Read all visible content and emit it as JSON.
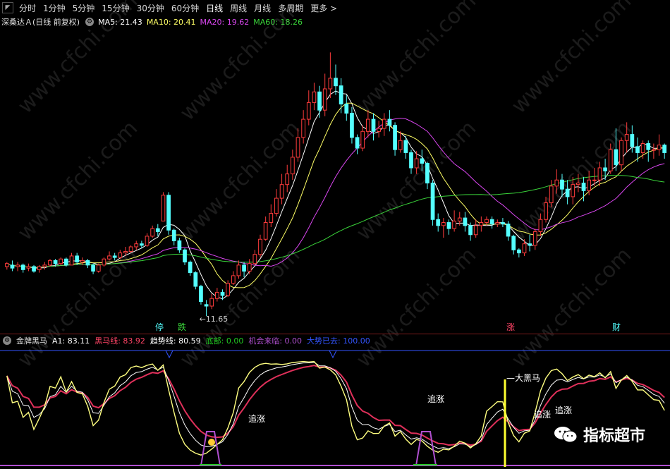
{
  "toolbar": {
    "tabs": [
      "分时",
      "1分钟",
      "5分钟",
      "15分钟",
      "30分钟",
      "60分钟",
      "日线",
      "周线",
      "月线",
      "多周期",
      "更多 >"
    ],
    "active": "日线"
  },
  "main_legend": {
    "stock": "深桑达Ａ(日线 前复权)",
    "ma5": "MA5: 21.43",
    "ma10": "MA10: 20.41",
    "ma20": "MA20: 19.62",
    "ma60": "MA60: 18.26",
    "colors": {
      "ma5": "#ffffff",
      "ma10": "#ffff66",
      "ma20": "#d946ef",
      "ma60": "#3ad43a"
    }
  },
  "annotations": {
    "low": "11.65",
    "ting": "停",
    "die": "跌",
    "zhang": "涨",
    "cai": "财"
  },
  "sub_legend": {
    "name": "金牌黑马",
    "a1": "A1: 83.11",
    "heima": "黑马线: 83.92",
    "qushi": "趋势线: 80.59",
    "dibu": "底部: 0.00",
    "jihui": "机会来临: 0.00",
    "dashi": "大势已去: 100.00",
    "colors": {
      "a1": "#ffffff",
      "heima": "#ff4466",
      "qushi": "#ffffff",
      "dibu": "#22cc22",
      "jihui": "#b050d0",
      "dashi": "#3355ff"
    }
  },
  "sub_labels": {
    "zhuizhang": "追涨",
    "daheima": "大黑马"
  },
  "chart_data": {
    "type": "candlestick",
    "candles": [
      [
        14.9,
        15.1,
        14.7,
        15.2
      ],
      [
        15.0,
        14.8,
        14.6,
        15.3
      ],
      [
        14.9,
        15.0,
        14.6,
        15.2
      ],
      [
        15.0,
        14.7,
        14.5,
        15.1
      ],
      [
        14.8,
        14.9,
        14.6,
        15.1
      ],
      [
        14.9,
        14.6,
        14.5,
        15.0
      ],
      [
        14.7,
        14.9,
        14.5,
        15.0
      ],
      [
        14.9,
        15.0,
        14.7,
        15.2
      ],
      [
        15.0,
        15.3,
        14.9,
        15.4
      ],
      [
        15.3,
        15.1,
        14.9,
        15.4
      ],
      [
        15.1,
        15.4,
        15.0,
        15.5
      ],
      [
        15.4,
        15.0,
        14.9,
        15.5
      ],
      [
        15.0,
        15.6,
        15.0,
        15.8
      ],
      [
        15.6,
        15.2,
        15.0,
        15.8
      ],
      [
        15.2,
        15.3,
        15.0,
        15.5
      ],
      [
        15.3,
        15.0,
        14.8,
        15.4
      ],
      [
        15.0,
        14.6,
        14.4,
        15.1
      ],
      [
        14.6,
        15.0,
        14.5,
        15.1
      ],
      [
        15.0,
        15.4,
        14.9,
        15.5
      ],
      [
        15.4,
        15.6,
        15.3,
        15.9
      ],
      [
        15.6,
        15.5,
        15.3,
        15.8
      ],
      [
        15.5,
        15.8,
        15.4,
        16.0
      ],
      [
        15.8,
        15.9,
        15.6,
        16.2
      ],
      [
        15.9,
        16.2,
        15.8,
        16.3
      ],
      [
        16.2,
        16.4,
        16.0,
        16.6
      ],
      [
        16.4,
        16.3,
        16.1,
        16.6
      ],
      [
        16.3,
        16.9,
        16.2,
        17.1
      ],
      [
        16.9,
        17.4,
        16.8,
        17.6
      ],
      [
        17.4,
        17.2,
        16.9,
        17.7
      ],
      [
        17.9,
        19.6,
        17.9,
        19.8
      ],
      [
        19.6,
        17.3,
        17.0,
        19.8
      ],
      [
        17.3,
        16.6,
        16.3,
        17.4
      ],
      [
        16.6,
        16.0,
        15.8,
        16.8
      ],
      [
        16.0,
        15.2,
        15.0,
        16.1
      ],
      [
        15.2,
        14.5,
        14.3,
        15.3
      ],
      [
        14.5,
        13.6,
        13.4,
        14.6
      ],
      [
        13.6,
        12.6,
        12.4,
        13.7
      ],
      [
        12.4,
        12.3,
        11.65,
        12.7
      ],
      [
        12.3,
        12.8,
        12.1,
        13.1
      ],
      [
        12.8,
        13.2,
        12.6,
        13.5
      ],
      [
        13.2,
        13.0,
        12.7,
        13.4
      ],
      [
        13.0,
        13.8,
        12.9,
        14.0
      ],
      [
        13.8,
        14.3,
        13.7,
        14.6
      ],
      [
        14.3,
        15.0,
        14.1,
        15.3
      ],
      [
        15.0,
        14.6,
        14.2,
        15.2
      ],
      [
        14.6,
        15.1,
        14.4,
        15.4
      ],
      [
        15.1,
        15.7,
        15.0,
        16.0
      ],
      [
        15.7,
        16.7,
        15.5,
        17.0
      ],
      [
        16.7,
        17.8,
        16.6,
        18.2
      ],
      [
        17.8,
        18.4,
        17.5,
        19.0
      ],
      [
        18.4,
        19.4,
        18.2,
        20.0
      ],
      [
        19.4,
        20.3,
        19.0,
        21.0
      ],
      [
        20.3,
        21.0,
        19.8,
        21.6
      ],
      [
        21.0,
        22.1,
        20.6,
        22.6
      ],
      [
        22.1,
        23.4,
        21.8,
        24.0
      ],
      [
        23.4,
        24.6,
        23.0,
        25.2
      ],
      [
        24.6,
        25.7,
        24.2,
        26.5
      ],
      [
        25.7,
        26.4,
        25.2,
        27.0
      ],
      [
        26.4,
        25.2,
        24.7,
        26.8
      ],
      [
        25.2,
        26.6,
        24.8,
        27.6
      ],
      [
        26.6,
        27.3,
        26.0,
        29.0
      ],
      [
        27.3,
        26.8,
        26.2,
        28.2
      ],
      [
        26.8,
        25.6,
        25.0,
        27.3
      ],
      [
        25.6,
        25.0,
        24.5,
        26.2
      ],
      [
        25.0,
        23.4,
        23.0,
        25.4
      ],
      [
        23.4,
        22.7,
        22.3,
        23.6
      ],
      [
        22.7,
        23.8,
        22.5,
        24.2
      ],
      [
        23.8,
        24.6,
        23.4,
        25.2
      ],
      [
        24.6,
        23.8,
        23.2,
        25.0
      ],
      [
        23.8,
        24.0,
        23.4,
        24.5
      ],
      [
        24.0,
        24.6,
        23.5,
        25.0
      ],
      [
        24.6,
        24.2,
        23.8,
        25.2
      ],
      [
        24.2,
        22.6,
        22.2,
        24.4
      ],
      [
        22.6,
        23.2,
        22.4,
        23.8
      ],
      [
        23.2,
        22.4,
        22.0,
        23.5
      ],
      [
        22.4,
        21.4,
        21.0,
        22.6
      ],
      [
        21.4,
        22.0,
        21.0,
        22.5
      ],
      [
        22.0,
        21.7,
        21.2,
        22.6
      ],
      [
        21.7,
        20.4,
        20.0,
        21.8
      ],
      [
        20.4,
        18.0,
        17.6,
        20.6
      ],
      [
        18.0,
        17.6,
        17.2,
        18.4
      ],
      [
        17.6,
        17.8,
        16.8,
        18.1
      ],
      [
        17.8,
        17.4,
        17.0,
        18.0
      ],
      [
        17.4,
        17.9,
        17.2,
        18.6
      ],
      [
        17.9,
        18.1,
        17.6,
        18.5
      ],
      [
        18.1,
        17.6,
        17.2,
        18.5
      ],
      [
        17.6,
        17.0,
        16.6,
        17.8
      ],
      [
        17.0,
        17.6,
        16.8,
        18.0
      ],
      [
        17.6,
        17.8,
        17.2,
        18.2
      ],
      [
        17.8,
        18.0,
        17.6,
        18.2
      ],
      [
        18.0,
        17.7,
        17.4,
        18.2
      ],
      [
        17.7,
        17.8,
        17.5,
        18.0
      ],
      [
        17.8,
        17.7,
        17.5,
        18.1
      ],
      [
        17.7,
        16.9,
        16.6,
        17.9
      ],
      [
        16.9,
        16.0,
        15.7,
        17.0
      ],
      [
        16.0,
        15.8,
        15.5,
        16.1
      ],
      [
        15.8,
        16.4,
        15.6,
        16.7
      ],
      [
        16.4,
        16.3,
        15.9,
        17.0
      ],
      [
        16.3,
        17.2,
        16.0,
        17.4
      ],
      [
        17.2,
        18.0,
        16.9,
        18.4
      ],
      [
        18.0,
        19.1,
        17.8,
        19.5
      ],
      [
        19.1,
        20.2,
        18.8,
        20.6
      ],
      [
        20.2,
        20.6,
        19.7,
        21.3
      ],
      [
        20.6,
        20.0,
        19.5,
        21.0
      ],
      [
        20.0,
        19.5,
        19.0,
        20.6
      ],
      [
        19.5,
        20.3,
        19.0,
        20.8
      ],
      [
        20.3,
        20.4,
        19.8,
        21.0
      ],
      [
        20.4,
        19.9,
        19.2,
        20.8
      ],
      [
        19.9,
        20.6,
        19.6,
        21.2
      ],
      [
        20.6,
        20.6,
        20.2,
        21.4
      ],
      [
        20.6,
        21.4,
        20.2,
        21.8
      ],
      [
        21.4,
        21.2,
        20.6,
        22.0
      ],
      [
        21.2,
        22.6,
        21.0,
        23.0
      ],
      [
        22.6,
        21.6,
        21.2,
        24.0
      ],
      [
        21.6,
        23.2,
        21.2,
        23.4
      ],
      [
        23.2,
        23.6,
        22.4,
        24.4
      ],
      [
        23.6,
        22.8,
        22.4,
        24.2
      ],
      [
        22.8,
        22.4,
        21.8,
        23.4
      ],
      [
        22.4,
        23.0,
        22.0,
        23.2
      ],
      [
        23.0,
        22.6,
        21.8,
        23.2
      ],
      [
        22.6,
        22.6,
        22.0,
        23.0
      ],
      [
        22.6,
        22.9,
        22.2,
        23.6
      ],
      [
        22.9,
        22.4,
        22.0,
        23.0
      ]
    ],
    "lows_label": "11.65",
    "ma_series": [
      "MA5",
      "MA10",
      "MA20",
      "MA60"
    ]
  }
}
